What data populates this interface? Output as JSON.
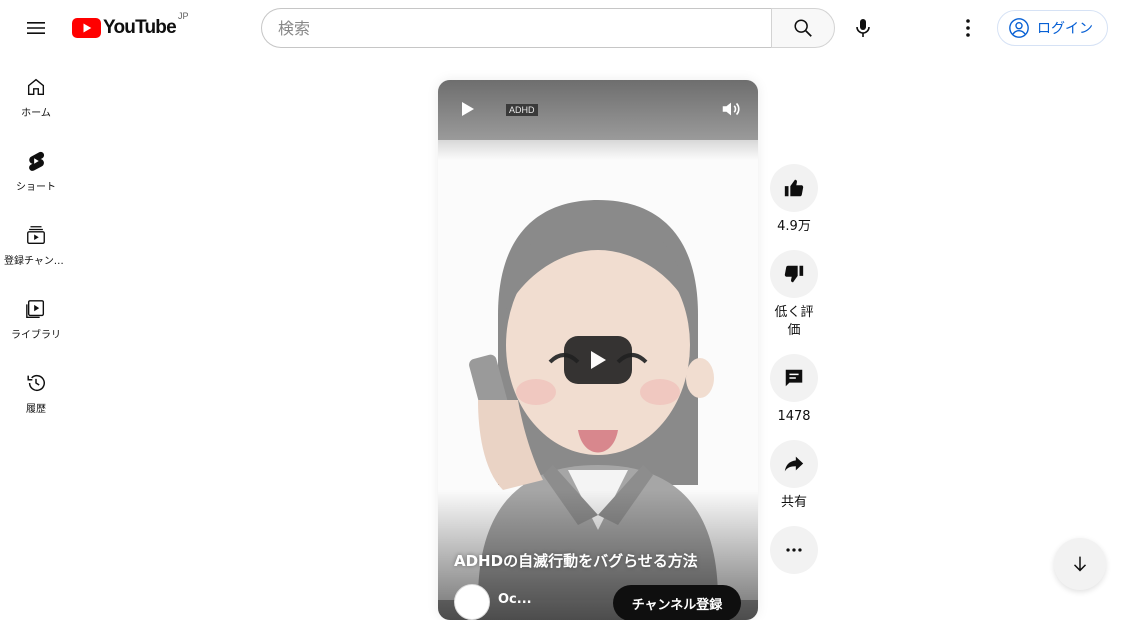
{
  "header": {
    "logo_text": "YouTube",
    "logo_region": "JP",
    "search_placeholder": "検索",
    "login_label": "ログイン"
  },
  "sidebar": {
    "items": [
      {
        "label": "ホーム",
        "icon": "home-icon"
      },
      {
        "label": "ショート",
        "icon": "shorts-icon"
      },
      {
        "label": "登録チャンネル",
        "icon": "subscriptions-icon"
      },
      {
        "label": "ライブラリ",
        "icon": "library-icon"
      },
      {
        "label": "履歴",
        "icon": "history-icon"
      }
    ]
  },
  "player": {
    "tag": "ADHD",
    "title": "ADHDの自滅行動をバグらせる方法",
    "channel_name": "Oc...",
    "subscribe_label": "チャンネル登録"
  },
  "actions": {
    "like_count": "4.9万",
    "dislike_label": "低く評価",
    "comment_count": "1478",
    "share_label": "共有"
  },
  "colors": {
    "brand_red": "#ff0000",
    "link_blue": "#065fd4"
  }
}
